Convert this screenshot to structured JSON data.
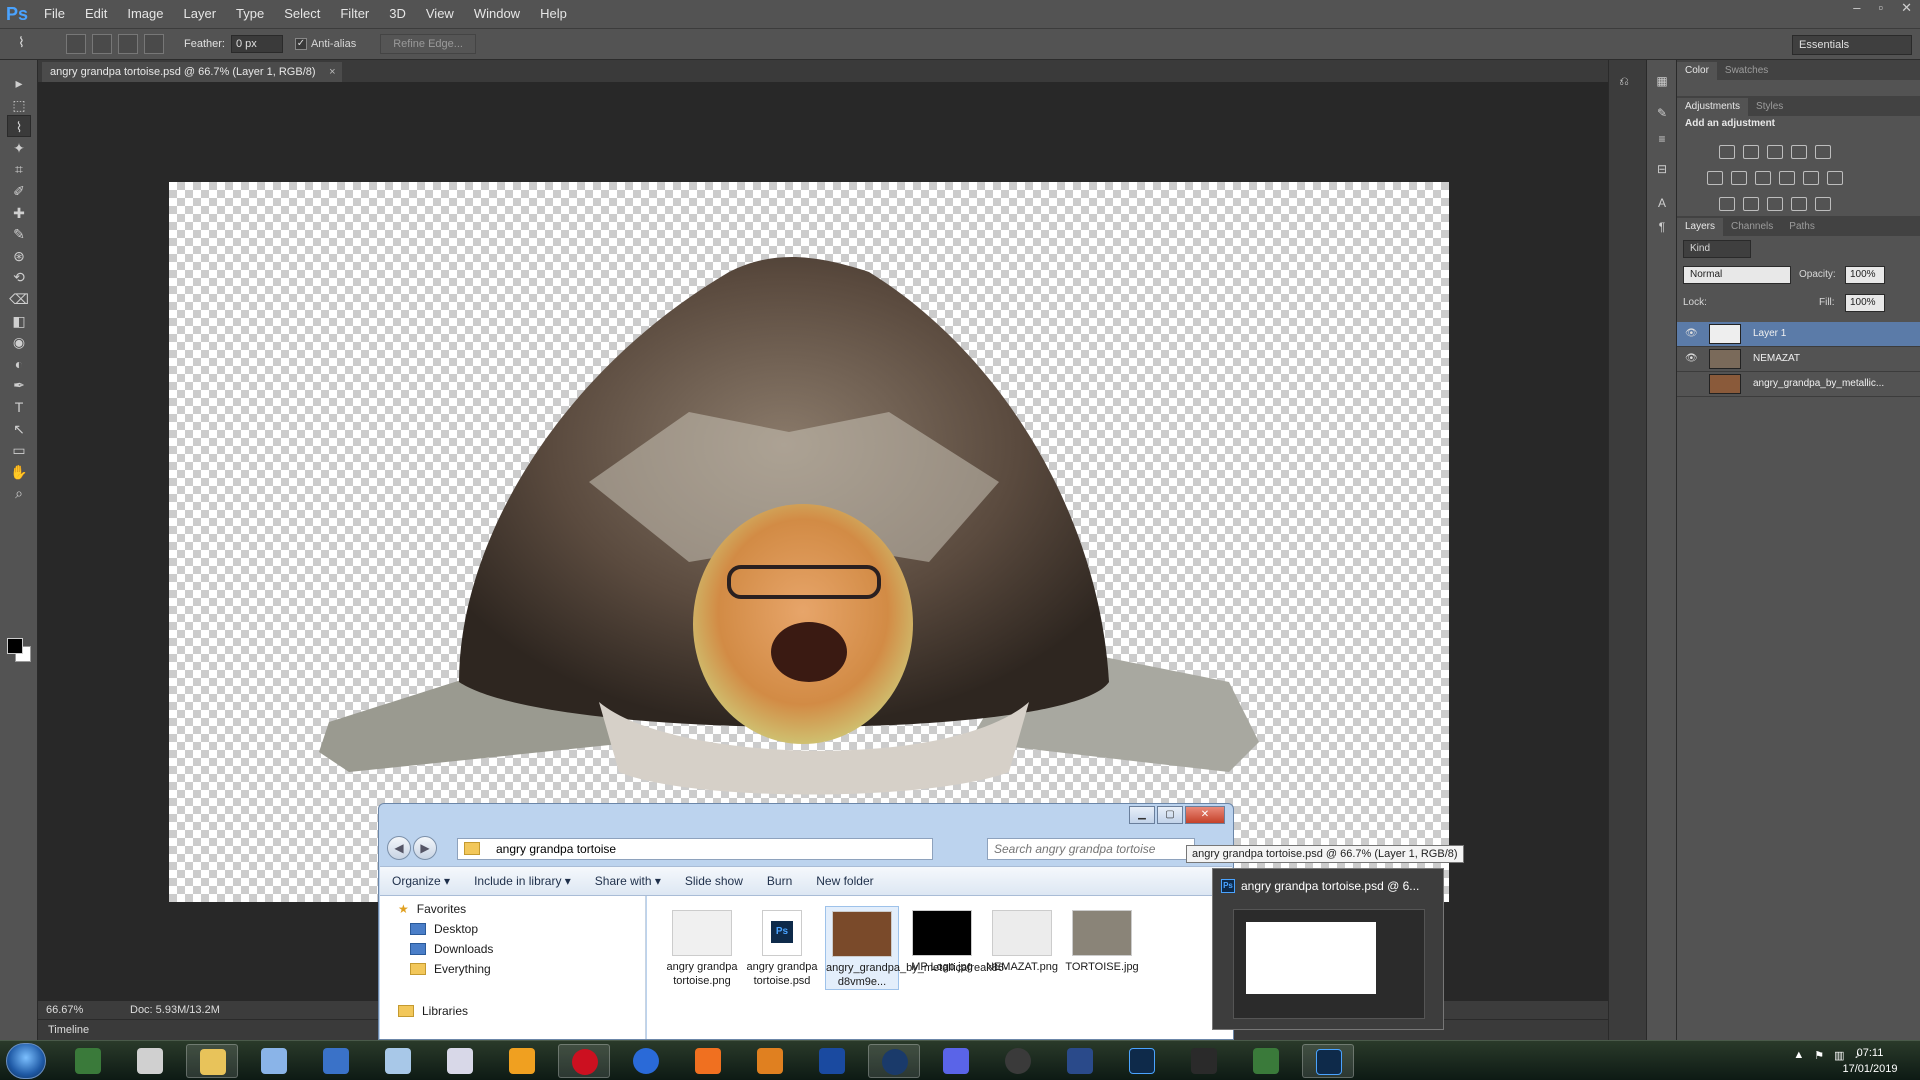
{
  "app": {
    "logo": "Ps",
    "window_controls": [
      "–",
      "▫",
      "✕"
    ]
  },
  "menu": [
    "File",
    "Edit",
    "Image",
    "Layer",
    "Type",
    "Select",
    "Filter",
    "3D",
    "View",
    "Window",
    "Help"
  ],
  "options": {
    "feather_label": "Feather:",
    "feather_value": "0 px",
    "antialias_label": "Anti-alias",
    "antialias_checked": true,
    "refine_edge": "Refine Edge...",
    "workspace": "Essentials"
  },
  "document": {
    "tab_title": "angry grandpa tortoise.psd @ 66.7% (Layer 1, RGB/8)",
    "close": "×"
  },
  "status": {
    "zoom": "66.67%",
    "doc_size": "Doc: 5.93M/13.2M"
  },
  "timeline_label": "Timeline",
  "tools": [
    "move-tool",
    "marquee-tool",
    "polygonal-lasso-tool",
    "magic-wand-tool",
    "crop-tool",
    "eyedropper-tool",
    "healing-brush-tool",
    "brush-tool",
    "clone-stamp-tool",
    "history-brush-tool",
    "eraser-tool",
    "paint-bucket-tool",
    "blur-tool",
    "dodge-tool",
    "pen-tool",
    "type-tool",
    "path-selection-tool",
    "rectangle-tool",
    "hand-tool",
    "zoom-tool"
  ],
  "panels": {
    "color_tabs": [
      "Color",
      "Swatches"
    ],
    "adj_tabs": [
      "Adjustments",
      "Styles"
    ],
    "adj_title": "Add an adjustment",
    "layers_tabs": [
      "Layers",
      "Channels",
      "Paths"
    ],
    "kind": "Kind",
    "blend_mode": "Normal",
    "opacity_label": "Opacity:",
    "opacity": "100%",
    "lock_label": "Lock:",
    "fill_label": "Fill:",
    "fill": "100%",
    "layers": [
      {
        "name": "Layer 1",
        "visible": true,
        "selected": true
      },
      {
        "name": "NEMAZAT",
        "visible": true,
        "selected": false
      },
      {
        "name": "angry_grandpa_by_metallic...",
        "visible": false,
        "selected": false
      }
    ]
  },
  "explorer": {
    "address": "angry grandpa tortoise",
    "search_placeholder": "Search angry grandpa tortoise",
    "commands": [
      "Organize ▾",
      "Include in library ▾",
      "Share with ▾",
      "Slide show",
      "Burn",
      "New folder"
    ],
    "nav": {
      "favorites": "Favorites",
      "items": [
        "Desktop",
        "Downloads",
        "Everything"
      ],
      "libraries": "Libraries"
    },
    "files": [
      {
        "name": "angry grandpa tortoise.png"
      },
      {
        "name": "angry grandpa tortoise.psd"
      },
      {
        "name": "angry_grandpa_by_metallicafreak86-d8vm9e..."
      },
      {
        "name": "MP Logo.jpg"
      },
      {
        "name": "NEMAZAT.png"
      },
      {
        "name": "TORTOISE.jpg"
      }
    ]
  },
  "tooltip": "angry grandpa tortoise.psd @ 66.7% (Layer 1, RGB/8)",
  "preview": {
    "title": "angry grandpa tortoise.psd @ 6..."
  },
  "taskbar": {
    "apps": [
      "computer",
      "clock-app",
      "file-explorer",
      "notepad",
      "paint",
      "browser-bird",
      "calculator",
      "winamp",
      "opera",
      "globe",
      "firefox",
      "gimp",
      "malwarebytes",
      "steam",
      "discord",
      "obs",
      "remote-desktop",
      "photoshop",
      "video-editor",
      "monitor",
      "photoshop-active"
    ],
    "time": "07:11",
    "date": "17/01/2019"
  }
}
